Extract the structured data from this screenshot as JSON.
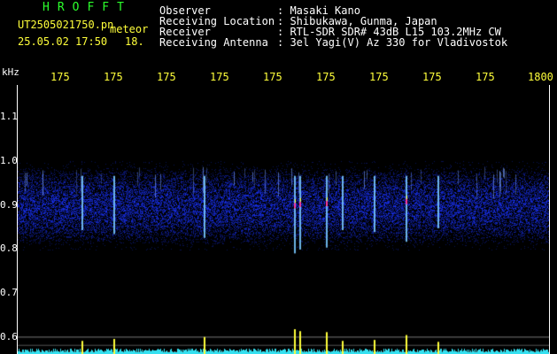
{
  "header": {
    "title": "HROFFT",
    "filename": "UT2505021750.pn",
    "meteor_tag": "meteor",
    "datetime": "25.05.02 17:50",
    "count": "18.",
    "labels": [
      "Observer",
      "Receiving Location",
      "Receiver",
      "Receiving Antenna"
    ],
    "values": [
      ": Masaki Kano",
      ": Shibukawa, Gunma, Japan",
      ": RTL-SDR SDR# 43dB L15 103.2MHz CW",
      ": 3el Yagi(V) Az 330 for Vladivostok"
    ]
  },
  "axis": {
    "unit_label": "kHz",
    "x_ticks": [
      "175",
      "175",
      "175",
      "175",
      "175",
      "175",
      "175",
      "175",
      "175",
      "1800"
    ],
    "y_ticks": [
      "1.1",
      "1.0",
      "0.9",
      "0.8",
      "0.7",
      "0.6"
    ]
  },
  "colors": {
    "background": "#000000",
    "text_white": "#ffffff",
    "text_yellow": "#ffff3a",
    "text_green": "#2cff2c",
    "noise_blue": "#1a2cff",
    "spectrum_cyan": "#35e0f0",
    "echo_yellow": "#ffff3a"
  },
  "chart_data": {
    "type": "heatmap",
    "band_center_khz": 0.905,
    "band_width_khz": 0.17,
    "ylim": [
      0.58,
      1.17
    ],
    "meteor_echoes": [
      {
        "x_index": 0.12,
        "peak": 0.4
      },
      {
        "x_index": 0.18,
        "peak": 0.5
      },
      {
        "x_index": 0.35,
        "peak": 0.6
      },
      {
        "x_index": 0.52,
        "peak": 1.0
      },
      {
        "x_index": 0.53,
        "peak": 0.9
      },
      {
        "x_index": 0.58,
        "peak": 0.85
      },
      {
        "x_index": 0.61,
        "peak": 0.4
      },
      {
        "x_index": 0.67,
        "peak": 0.45
      },
      {
        "x_index": 0.73,
        "peak": 0.7
      },
      {
        "x_index": 0.79,
        "peak": 0.35
      }
    ]
  }
}
